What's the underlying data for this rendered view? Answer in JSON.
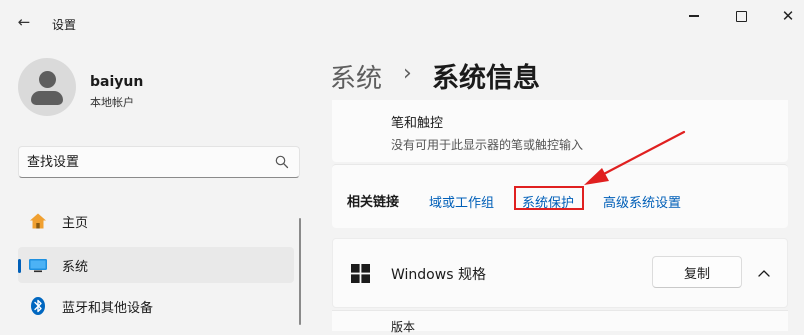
{
  "window": {
    "title": "设置",
    "back_icon": "arrow-left-icon",
    "close_glyph": "✕"
  },
  "account": {
    "name": "baiyun",
    "type": "本地帐户"
  },
  "search": {
    "placeholder": "查找设置"
  },
  "sidebar": {
    "items": [
      {
        "label": "主页",
        "icon": "home-icon"
      },
      {
        "label": "系统",
        "icon": "system-icon",
        "selected": true
      },
      {
        "label": "蓝牙和其他设备",
        "icon": "bluetooth-icon"
      }
    ]
  },
  "header": {
    "parent": "系统",
    "separator": "›",
    "current": "系统信息"
  },
  "pen_touch": {
    "title": "笔和触控",
    "description": "没有可用于此显示器的笔或触控输入"
  },
  "related_links": {
    "title": "相关链接",
    "links": [
      "域或工作组",
      "系统保护",
      "高级系统设置"
    ]
  },
  "windows_spec": {
    "title": "Windows 规格",
    "copy_label": "复制",
    "next_label": "版本"
  },
  "colors": {
    "accent": "#005fb8",
    "highlight": "#e02020",
    "home_icon": "#f0a030",
    "bluetooth_icon": "#0067c0"
  }
}
